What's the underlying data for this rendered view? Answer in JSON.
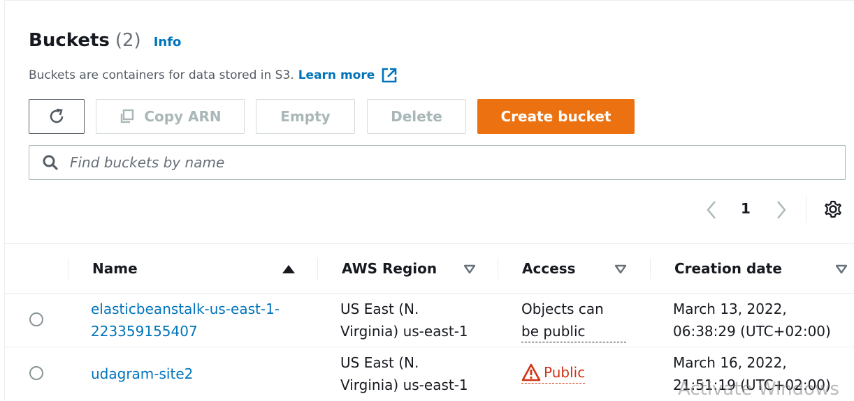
{
  "header": {
    "title": "Buckets",
    "count": "(2)",
    "info_label": "Info",
    "description": "Buckets are containers for data stored in S3.",
    "learn_more_label": "Learn more"
  },
  "toolbar": {
    "refresh_icon": "refresh-icon",
    "copy_arn_label": "Copy ARN",
    "empty_label": "Empty",
    "delete_label": "Delete",
    "create_label": "Create bucket"
  },
  "search": {
    "placeholder": "Find buckets by name",
    "value": ""
  },
  "pagination": {
    "current_page": "1"
  },
  "table": {
    "columns": [
      {
        "label": "Name",
        "sort": "ascending"
      },
      {
        "label": "AWS Region",
        "sort": "none"
      },
      {
        "label": "Access",
        "sort": "none"
      },
      {
        "label": "Creation date",
        "sort": "none"
      }
    ],
    "rows": [
      {
        "name_line1": "elasticbeanstalk-us-east-1-",
        "name_line2": "223359155407",
        "region_line1": "US East (N.",
        "region_line2": "Virginia) us-east-1",
        "access_line1": "Objects can",
        "access_line2": "be public",
        "date_line1": "March 13, 2022,",
        "date_line2": "06:38:29 (UTC+02:00)"
      },
      {
        "name": "udagram-site2",
        "region_line1": "US East (N.",
        "region_line2": "Virginia) us-east-1",
        "access": "Public",
        "date_line1": "March 16, 2022,",
        "date_line2": "21:51:19 (UTC+02:00)"
      }
    ]
  },
  "watermark": "Activate Windows",
  "colors": {
    "accent": "#ec7211",
    "link": "#0073bb",
    "warning": "#d13212",
    "disabled_text": "#aab7b8"
  }
}
